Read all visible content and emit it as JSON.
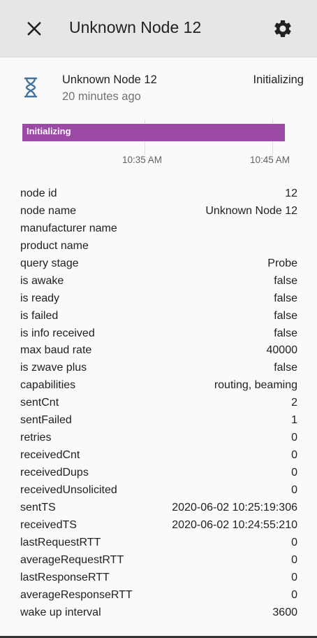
{
  "header": {
    "title": "Unknown Node 12",
    "close_icon": "close-icon",
    "settings_icon": "gear-icon"
  },
  "entity": {
    "icon": "hourglass-icon",
    "name": "Unknown Node 12",
    "last_changed": "20 minutes ago",
    "state": "Initializing"
  },
  "timeline": {
    "bar_label": "Initializing",
    "bar_color": "#9b4aa6",
    "ticks": [
      "10:35 AM",
      "10:45 AM"
    ]
  },
  "attributes": [
    {
      "key": "node id",
      "value": "12"
    },
    {
      "key": "node name",
      "value": "Unknown Node 12"
    },
    {
      "key": "manufacturer name",
      "value": ""
    },
    {
      "key": "product name",
      "value": ""
    },
    {
      "key": "query stage",
      "value": "Probe"
    },
    {
      "key": "is awake",
      "value": "false"
    },
    {
      "key": "is ready",
      "value": "false"
    },
    {
      "key": "is failed",
      "value": "false"
    },
    {
      "key": "is info received",
      "value": "false"
    },
    {
      "key": "max baud rate",
      "value": "40000"
    },
    {
      "key": "is zwave plus",
      "value": "false"
    },
    {
      "key": "capabilities",
      "value": "routing, beaming"
    },
    {
      "key": "sentCnt",
      "value": "2"
    },
    {
      "key": "sentFailed",
      "value": "1"
    },
    {
      "key": "retries",
      "value": "0"
    },
    {
      "key": "receivedCnt",
      "value": "0"
    },
    {
      "key": "receivedDups",
      "value": "0"
    },
    {
      "key": "receivedUnsolicited",
      "value": "0"
    },
    {
      "key": "sentTS",
      "value": "2020-06-02 10:25:19:306"
    },
    {
      "key": "receivedTS",
      "value": "2020-06-02 10:24:55:210"
    },
    {
      "key": "lastRequestRTT",
      "value": "0"
    },
    {
      "key": "averageRequestRTT",
      "value": "0"
    },
    {
      "key": "lastResponseRTT",
      "value": "0"
    },
    {
      "key": "averageResponseRTT",
      "value": "0"
    },
    {
      "key": "wake up interval",
      "value": "3600"
    }
  ]
}
